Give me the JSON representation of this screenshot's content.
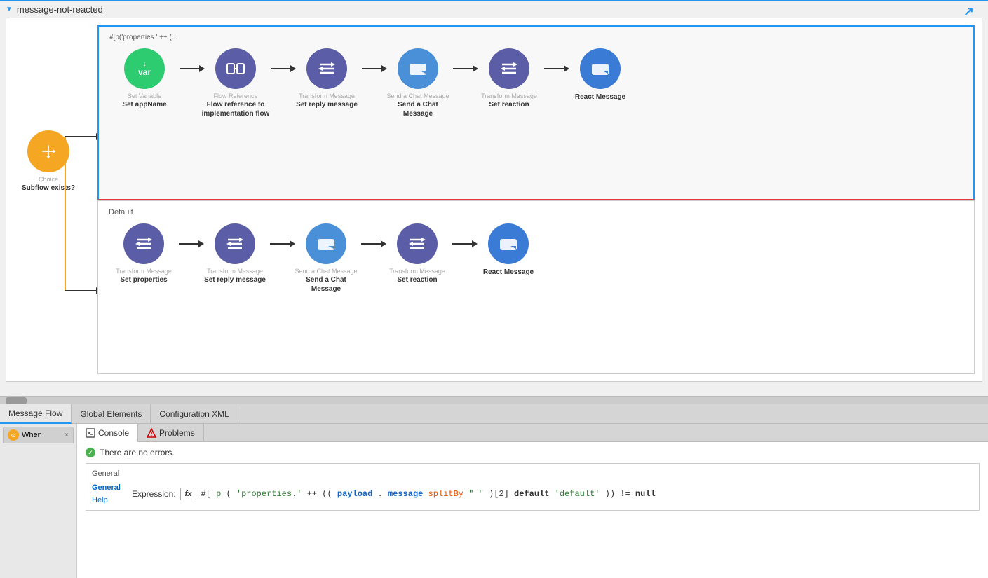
{
  "flow": {
    "title": "message-not-reacted",
    "expression": "#[p('properties.' ++ (..."
  },
  "tabs": [
    {
      "label": "Message Flow",
      "active": true
    },
    {
      "label": "Global Elements",
      "active": false
    },
    {
      "label": "Configuration XML",
      "active": false
    }
  ],
  "choice_node": {
    "type": "Choice",
    "name": "Subflow exists?"
  },
  "top_branch": {
    "label": "#[p('properties.' ++ (...",
    "nodes": [
      {
        "type": "Set Variable",
        "name": "Set appName",
        "color": "green"
      },
      {
        "type": "Flow Reference",
        "name": "Flow reference to implementation flow",
        "color": "indigo"
      },
      {
        "type": "Transform Message",
        "name": "Set reply message",
        "color": "indigo"
      },
      {
        "type": "Send a Chat Message",
        "name": "Send a Chat Message",
        "color": "blue"
      },
      {
        "type": "Transform Message",
        "name": "Set reaction",
        "color": "indigo"
      },
      {
        "type": "React Message",
        "name": "React Message",
        "color": "blue-medium"
      }
    ]
  },
  "bottom_branch": {
    "label": "Default",
    "nodes": [
      {
        "type": "Transform Message",
        "name": "Set properties",
        "color": "indigo"
      },
      {
        "type": "Transform Message",
        "name": "Set reply message",
        "color": "indigo"
      },
      {
        "type": "Send a Chat Message",
        "name": "Send a Chat Message",
        "color": "blue"
      },
      {
        "type": "Transform Message",
        "name": "Set reaction",
        "color": "indigo"
      },
      {
        "type": "React Message",
        "name": "React Message",
        "color": "blue-medium"
      }
    ]
  },
  "bottom_tabs": {
    "when_label": "When",
    "console_label": "Console",
    "problems_label": "Problems",
    "close_symbol": "×"
  },
  "console": {
    "no_errors_text": "There are no errors.",
    "general_label": "General",
    "expression_label": "Expression:",
    "fx_label": "fx",
    "expression_value": "#[ p('properties.' ++ ((payload.message splitBy \" \")[2] default 'default')) != null"
  },
  "left_panel": {
    "general_label": "General",
    "help_label": "Help"
  },
  "icons": {
    "var": "var",
    "flow_ref": "⊞",
    "transform": "≋",
    "camera": "▶",
    "choice": "⇌"
  }
}
